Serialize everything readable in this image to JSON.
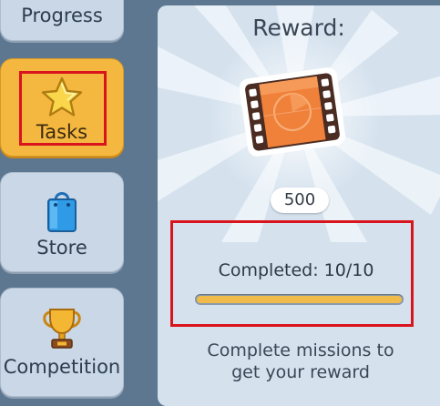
{
  "sidebar": {
    "items": [
      {
        "label": "Progress",
        "icon": "progress-icon"
      },
      {
        "label": "Tasks",
        "icon": "star-icon",
        "active": true
      },
      {
        "label": "Store",
        "icon": "shopping-bag-icon"
      },
      {
        "label": "Competition",
        "icon": "trophy-icon"
      }
    ]
  },
  "reward": {
    "title": "Reward:",
    "icon": "film-reel-icon",
    "amount": "500",
    "completed_label": "Completed: 10/10",
    "progress_fraction": 1.0,
    "description": "Complete missions to get your reward"
  },
  "colors": {
    "active_tab": "#f4b840",
    "progress_fill": "#f0bb4a",
    "highlight": "#d9141c"
  }
}
